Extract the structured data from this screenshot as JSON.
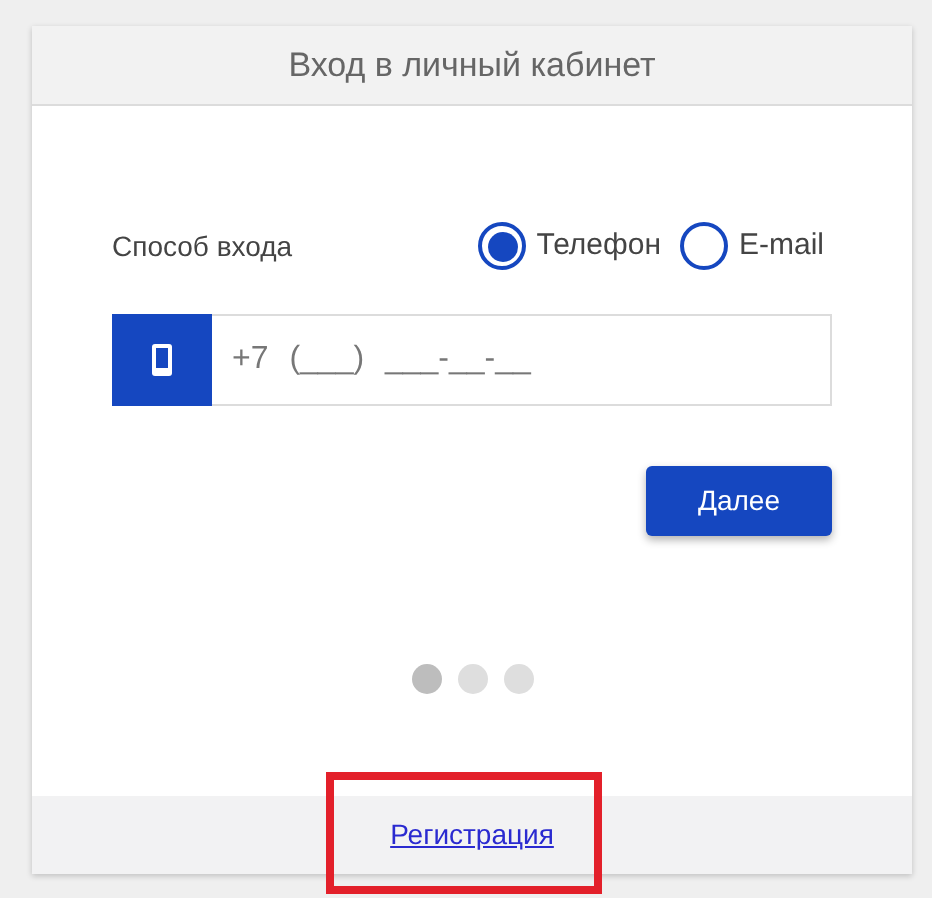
{
  "card": {
    "title": "Вход в личный кабинет"
  },
  "login_method": {
    "label": "Способ входа",
    "options": [
      {
        "label": "Телефон",
        "selected": true
      },
      {
        "label": "E-mail",
        "selected": false
      }
    ]
  },
  "phone_field": {
    "placeholder": "+7 (___) ___-__-__"
  },
  "next_button": {
    "label": "Далее"
  },
  "pager": [
    {
      "selected": true
    },
    {
      "selected": false
    },
    {
      "selected": false
    }
  ],
  "footer": {
    "link": "Регистрация"
  },
  "annotation": {
    "kind": "highlight"
  }
}
